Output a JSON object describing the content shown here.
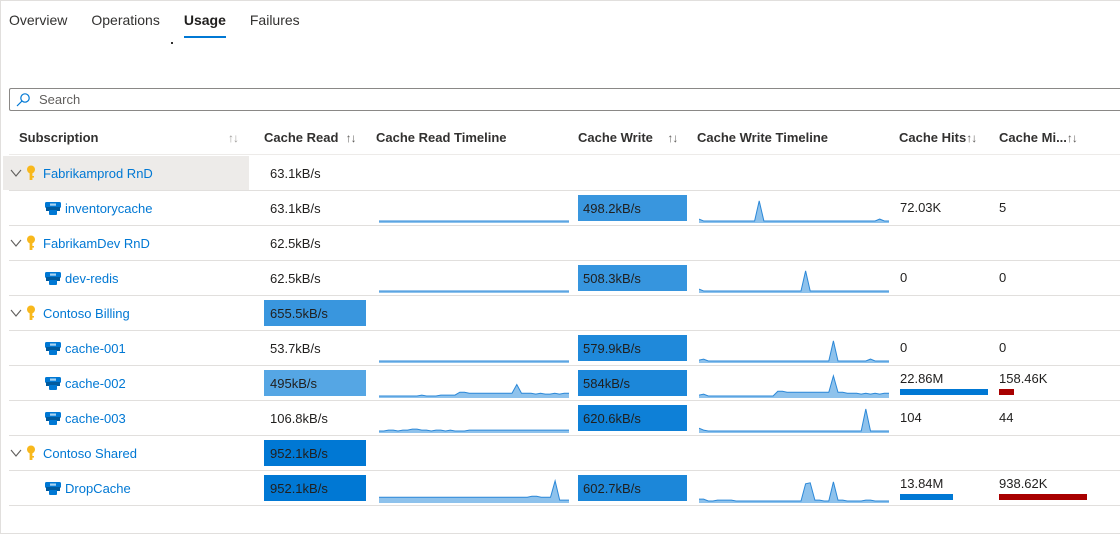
{
  "tabs": [
    {
      "label": "Overview",
      "active": false
    },
    {
      "label": "Operations",
      "active": false
    },
    {
      "label": "Usage",
      "active": true
    },
    {
      "label": "Failures",
      "active": false
    }
  ],
  "search": {
    "placeholder": "Search",
    "value": "",
    "icon": "search-icon"
  },
  "columns": [
    {
      "label": "Subscription",
      "sortable": true
    },
    {
      "label": "Cache Read",
      "sortable": true
    },
    {
      "label": "Cache Read Timeline",
      "sortable": false
    },
    {
      "label": "Cache Write",
      "sortable": true
    },
    {
      "label": "Cache Write Timeline",
      "sortable": false
    },
    {
      "label": "Cache Hits",
      "sortable": true
    },
    {
      "label": "Cache Mi...",
      "sortable": true
    }
  ],
  "sort_glyph": "↑↓",
  "colors": {
    "accent": "#0078d4",
    "link": "#0078d4",
    "hits_bar": "#0078d4",
    "miss_bar": "#a80000",
    "sparkline_stroke": "#2b88d8",
    "sparkline_fill": "#8ec2ec",
    "key_icon": "#f8b81c",
    "redis_icon": "#0078d4"
  },
  "rows": [
    {
      "type": "group",
      "name": "Fabrikamprod RnD",
      "icon": "key-icon",
      "expanded": true,
      "selected": true,
      "cache_read": "63.1kB/s",
      "cache_read_heat": 0,
      "cache_write": "",
      "cache_write_heat": 0,
      "cache_hits": "",
      "cache_misses": ""
    },
    {
      "type": "item",
      "name": "inventorycache",
      "icon": "redis-cache-icon",
      "cache_read": "63.1kB/s",
      "cache_read_heat": 0,
      "cache_write": "498.2kB/s",
      "cache_write_heat": 0.6,
      "read_timeline": [
        1,
        1,
        1,
        1,
        1,
        1,
        1,
        1,
        1,
        1,
        1,
        1,
        1,
        1,
        1,
        1,
        1,
        1,
        1,
        1
      ],
      "write_timeline": [
        3,
        1,
        1,
        1,
        1,
        1,
        1,
        1,
        1,
        1,
        1,
        1,
        1,
        22,
        1,
        1,
        1,
        1,
        1,
        1,
        1,
        1,
        1,
        1,
        1,
        1,
        1,
        1,
        1,
        1,
        1,
        1,
        1,
        1,
        1,
        1,
        1,
        1,
        1,
        3,
        1,
        1
      ],
      "cache_hits": "72.03K",
      "hits_fraction": 0,
      "cache_misses": "5",
      "misses_fraction": 0
    },
    {
      "type": "group",
      "name": "FabrikamDev RnD",
      "icon": "key-icon",
      "expanded": true,
      "selected": false,
      "cache_read": "62.5kB/s",
      "cache_read_heat": 0,
      "cache_write": "",
      "cache_write_heat": 0,
      "cache_hits": "",
      "cache_misses": ""
    },
    {
      "type": "item",
      "name": "dev-redis",
      "icon": "redis-cache-icon",
      "cache_read": "62.5kB/s",
      "cache_read_heat": 0,
      "cache_write": "508.3kB/s",
      "cache_write_heat": 0.62,
      "read_timeline": [
        1,
        1,
        1,
        1,
        1,
        1,
        1,
        1,
        1,
        1,
        1,
        1,
        1,
        1,
        1,
        1,
        1,
        1,
        1,
        1
      ],
      "write_timeline": [
        3,
        1,
        1,
        1,
        1,
        1,
        1,
        1,
        1,
        1,
        1,
        1,
        1,
        1,
        1,
        1,
        1,
        1,
        1,
        1,
        1,
        1,
        1,
        22,
        1,
        1,
        1,
        1,
        1,
        1,
        1,
        1,
        1,
        1,
        1,
        1,
        1,
        1,
        1,
        1,
        1,
        1
      ],
      "cache_hits": "0",
      "hits_fraction": 0,
      "cache_misses": "0",
      "misses_fraction": 0
    },
    {
      "type": "group",
      "name": "Contoso Billing",
      "icon": "key-icon",
      "expanded": true,
      "selected": false,
      "cache_read": "655.5kB/s",
      "cache_read_heat": 0.6,
      "cache_write": "",
      "cache_write_heat": 0,
      "cache_hits": "",
      "cache_misses": ""
    },
    {
      "type": "item",
      "name": "cache-001",
      "icon": "redis-cache-icon",
      "cache_read": "53.7kB/s",
      "cache_read_heat": 0,
      "cache_write": "579.9kB/s",
      "cache_write_heat": 0.78,
      "read_timeline": [
        1,
        1,
        1,
        1,
        1,
        1,
        1,
        1,
        1,
        1,
        1,
        1,
        1,
        1,
        1,
        1,
        1,
        1,
        1,
        1
      ],
      "write_timeline": [
        2,
        3,
        1,
        1,
        1,
        1,
        1,
        1,
        1,
        1,
        1,
        1,
        1,
        1,
        1,
        1,
        1,
        1,
        1,
        1,
        1,
        1,
        1,
        1,
        1,
        1,
        1,
        1,
        1,
        22,
        1,
        1,
        1,
        1,
        1,
        1,
        1,
        3,
        1,
        1,
        1,
        1
      ],
      "cache_hits": "0",
      "hits_fraction": 0,
      "cache_misses": "0",
      "misses_fraction": 0
    },
    {
      "type": "item",
      "name": "cache-002",
      "icon": "redis-cache-icon",
      "cache_read": "495kB/s",
      "cache_read_heat": 0.4,
      "cache_write": "584kB/s",
      "cache_write_heat": 0.8,
      "read_timeline": [
        1,
        1,
        1,
        1,
        1,
        1,
        1,
        1,
        1,
        2,
        1,
        1,
        1,
        2,
        2,
        2,
        2,
        5,
        5,
        4,
        4,
        4,
        4,
        4,
        4,
        4,
        4,
        4,
        4,
        13,
        4,
        4,
        4,
        3,
        4,
        3,
        3,
        4,
        3,
        4,
        4
      ],
      "write_timeline": [
        2,
        3,
        1,
        1,
        1,
        1,
        1,
        1,
        1,
        1,
        1,
        1,
        1,
        1,
        1,
        1,
        1,
        6,
        6,
        5,
        5,
        5,
        5,
        5,
        5,
        5,
        5,
        5,
        5,
        22,
        5,
        5,
        4,
        4,
        4,
        3,
        4,
        3,
        4,
        3,
        4,
        4
      ],
      "cache_hits": "22.86M",
      "hits_fraction": 1.0,
      "cache_misses": "158.46K",
      "misses_fraction": 0.17
    },
    {
      "type": "item",
      "name": "cache-003",
      "icon": "redis-cache-icon",
      "cache_read": "106.8kB/s",
      "cache_read_heat": 0,
      "cache_write": "620.6kB/s",
      "cache_write_heat": 0.9,
      "read_timeline": [
        1,
        1,
        2,
        2,
        1,
        2,
        2,
        3,
        3,
        2,
        2,
        1,
        2,
        2,
        1,
        2,
        1,
        1,
        1,
        2,
        2,
        2,
        2,
        2,
        2,
        2,
        2,
        2,
        2,
        2,
        2,
        2,
        2,
        2,
        2,
        2,
        2,
        2,
        2,
        2,
        2
      ],
      "write_timeline": [
        4,
        2,
        1,
        1,
        1,
        1,
        1,
        1,
        1,
        1,
        1,
        1,
        1,
        1,
        1,
        1,
        1,
        1,
        1,
        1,
        1,
        1,
        1,
        1,
        1,
        1,
        1,
        1,
        1,
        1,
        1,
        1,
        1,
        1,
        1,
        1,
        24,
        1,
        1,
        1,
        1,
        1
      ],
      "cache_hits": "104",
      "hits_fraction": 0,
      "cache_misses": "44",
      "misses_fraction": 0
    },
    {
      "type": "group",
      "name": "Contoso Shared",
      "icon": "key-icon",
      "expanded": true,
      "selected": false,
      "cache_read": "952.1kB/s",
      "cache_read_heat": 1.0,
      "cache_write": "",
      "cache_write_heat": 0,
      "cache_hits": "",
      "cache_misses": ""
    },
    {
      "type": "item",
      "name": "DropCache",
      "icon": "redis-cache-icon",
      "cache_read": "952.1kB/s",
      "cache_read_heat": 1.0,
      "cache_write": "602.7kB/s",
      "cache_write_heat": 0.8,
      "read_timeline": [
        5,
        5,
        5,
        5,
        5,
        5,
        5,
        5,
        5,
        5,
        5,
        5,
        5,
        5,
        5,
        5,
        5,
        5,
        5,
        5,
        5,
        5,
        5,
        5,
        5,
        5,
        5,
        5,
        5,
        5,
        5,
        5,
        5,
        6,
        6,
        5,
        5,
        5,
        22,
        2,
        2,
        2
      ],
      "write_timeline": [
        3,
        3,
        1,
        1,
        2,
        2,
        2,
        2,
        1,
        1,
        1,
        1,
        1,
        1,
        1,
        1,
        1,
        1,
        1,
        1,
        1,
        1,
        1,
        19,
        20,
        2,
        2,
        1,
        1,
        21,
        2,
        2,
        1,
        1,
        1,
        1,
        2,
        2,
        1,
        1,
        1,
        1
      ],
      "cache_hits": "13.84M",
      "hits_fraction": 0.6,
      "cache_misses": "938.62K",
      "misses_fraction": 1.0
    }
  ]
}
